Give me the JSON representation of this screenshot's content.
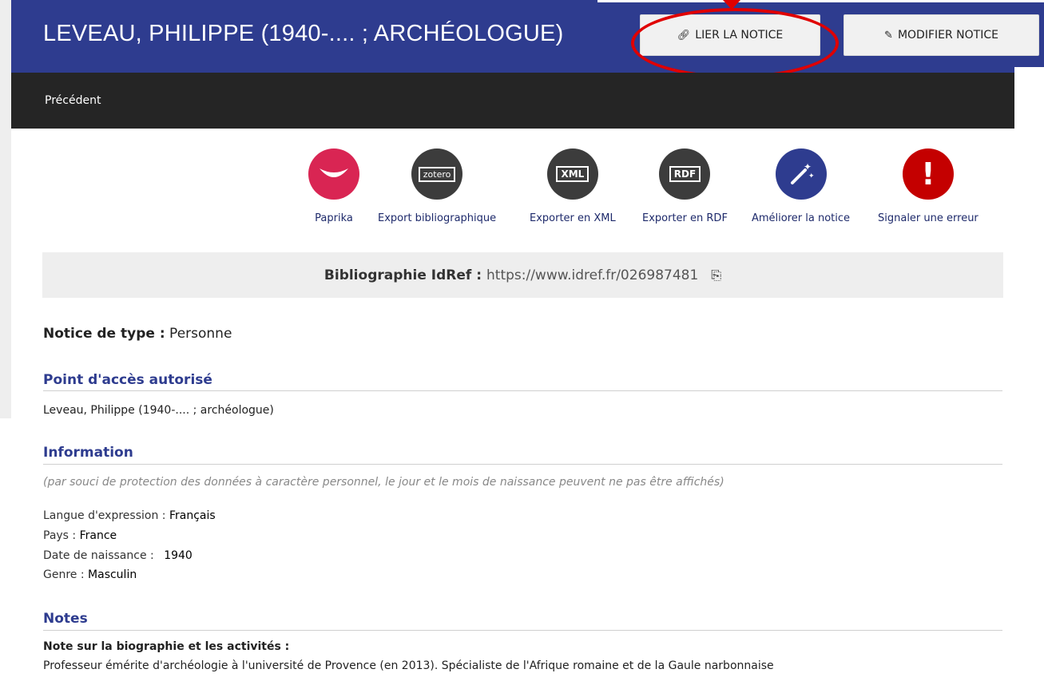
{
  "header": {
    "title": "LEVEAU, PHILIPPE (1940-.... ; ARCHÉOLOGUE)",
    "lier_label": "LIER LA NOTICE",
    "modifier_label": "MODIFIER NOTICE"
  },
  "nav": {
    "previous": "Précédent"
  },
  "tools": [
    {
      "label": "Paprika",
      "icon": "paprika-icon"
    },
    {
      "label": "Export bibliographique",
      "icon": "zotero-icon",
      "badge": "zotero"
    },
    {
      "label": "Exporter en XML",
      "icon": "xml-export-icon",
      "badge": "XML"
    },
    {
      "label": "Exporter en RDF",
      "icon": "rdf-export-icon",
      "badge": "RDF"
    },
    {
      "label": "Améliorer la notice",
      "icon": "magic-wand-icon"
    },
    {
      "label": "Signaler une erreur",
      "icon": "exclamation-icon",
      "badge": "!"
    }
  ],
  "biblio": {
    "label": "Bibliographie IdRef :",
    "url": "https://www.idref.fr/026987481"
  },
  "notice": {
    "type_label": "Notice de type :",
    "type_value": "Personne"
  },
  "sections": {
    "access_point": {
      "title": "Point d'accès autorisé",
      "value": "Leveau, Philippe (1940-.... ; archéologue)"
    },
    "information": {
      "title": "Information",
      "privacy_note": "(par souci de protection des données à caractère personnel, le jour et le mois de naissance peuvent ne pas être affichés)",
      "langue_label": "Langue d'expression :",
      "langue_value": "Français",
      "pays_label": "Pays :",
      "pays_value": "France",
      "naissance_label": "Date de naissance :",
      "naissance_value": "1940",
      "genre_label": "Genre :",
      "genre_value": "Masculin"
    },
    "notes": {
      "title": "Notes",
      "bio_label": "Note sur la biographie et les activités :",
      "bio_text": "Professeur émérite d'archéologie à l'université de Provence (en 2013). Spécialiste de l'Afrique romaine et de la Gaule narbonnaise"
    }
  },
  "colors": {
    "header": "#2e3c8f",
    "navbar": "#252525",
    "accent_red": "#e00000",
    "paprika": "#d92553"
  }
}
